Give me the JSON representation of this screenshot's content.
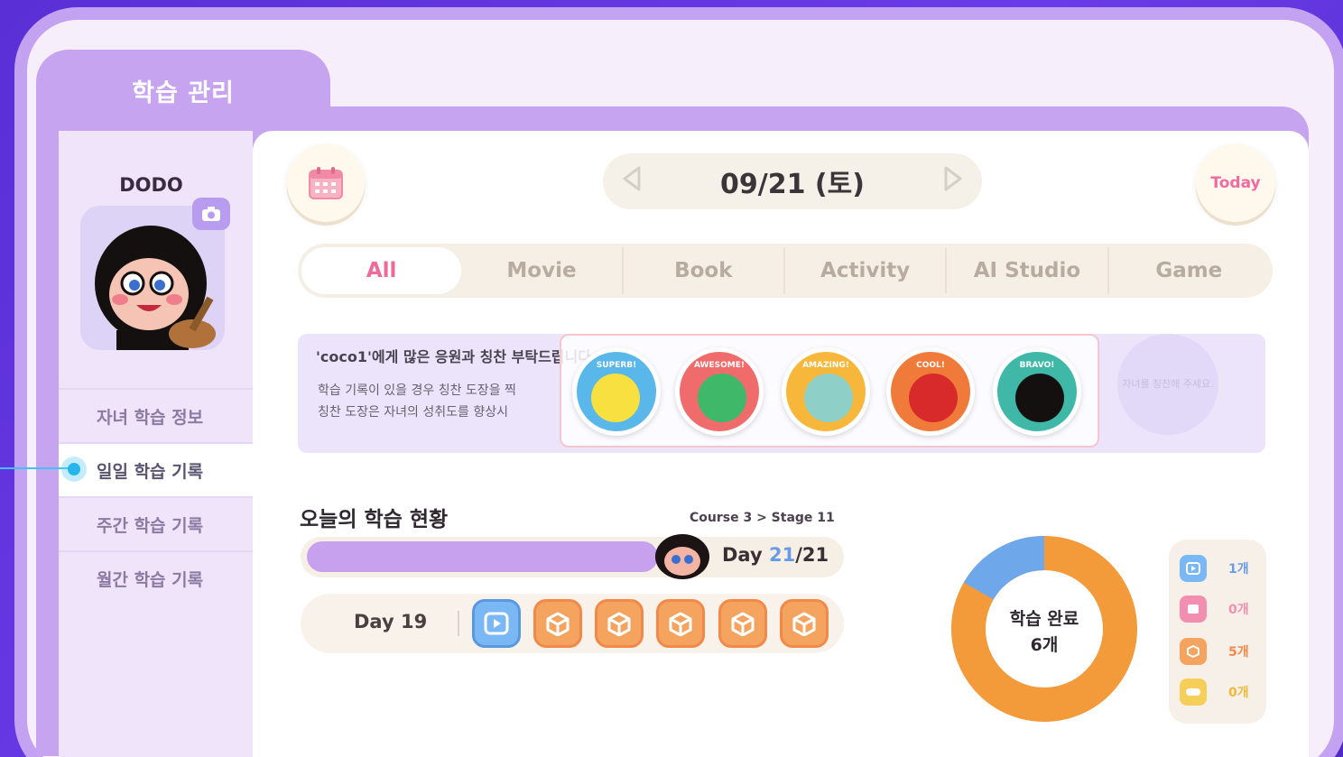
{
  "header": {
    "section_tab": "학습 관리"
  },
  "profile": {
    "name": "DODO"
  },
  "sidebar": {
    "items": [
      {
        "label": "자녀 학습 정보"
      },
      {
        "label": "일일 학습 기록"
      },
      {
        "label": "주간 학습 기록"
      },
      {
        "label": "월간 학습 기록"
      }
    ],
    "active_index": 1
  },
  "date_nav": {
    "date": "09/21 (토)",
    "today_label": "Today"
  },
  "tabs": [
    "All",
    "Movie",
    "Book",
    "Activity",
    "AI Studio",
    "Game"
  ],
  "banner": {
    "title": "'coco1'에게 많은 응원과 칭찬 부탁드립니다",
    "line1": "학습 기록이 있을 경우 칭찬 도장을 찍",
    "line2": "칭찬 도장은 자녀의 성취도를 향상시",
    "stickers": [
      {
        "label": "SUPERB!",
        "color": "#5ab7ea"
      },
      {
        "label": "AWESOME!",
        "color": "#f06b6b"
      },
      {
        "label": "AMAZING!",
        "color": "#f7b73a"
      },
      {
        "label": "COOL!",
        "color": "#f07a3a"
      },
      {
        "label": "BRAVO!",
        "color": "#3fb8a8"
      }
    ],
    "empty_slot_text": "자녀를 칭찬해 주세요."
  },
  "today_status": {
    "title": "오늘의 학습 현황",
    "course": "Course 3 > Stage 11",
    "progress": {
      "day_prefix": "Day",
      "current": 21,
      "total": 21,
      "separator": "/",
      "fill_fraction": 0.66
    },
    "day_label": "Day 19",
    "activities": [
      "movie",
      "cube",
      "cube",
      "cube",
      "cube",
      "cube"
    ]
  },
  "completion": {
    "label": "학습 완료",
    "count_text": "6개",
    "colors": {
      "blue": "#6ea8ea",
      "orange": "#f39a3a"
    },
    "legend": [
      {
        "icon": "video-icon",
        "count": "1개",
        "color": "#7ab8f5",
        "text_color": "#6a9be8"
      },
      {
        "icon": "book-icon",
        "count": "0개",
        "color": "#f28fb0",
        "text_color": "#f28fb0"
      },
      {
        "icon": "activity-icon",
        "count": "5개",
        "color": "#f5a460",
        "text_color": "#f0894a"
      },
      {
        "icon": "game-icon",
        "count": "0개",
        "color": "#f6cf5a",
        "text_color": "#f0b93a"
      }
    ],
    "segments": [
      1,
      5
    ]
  }
}
